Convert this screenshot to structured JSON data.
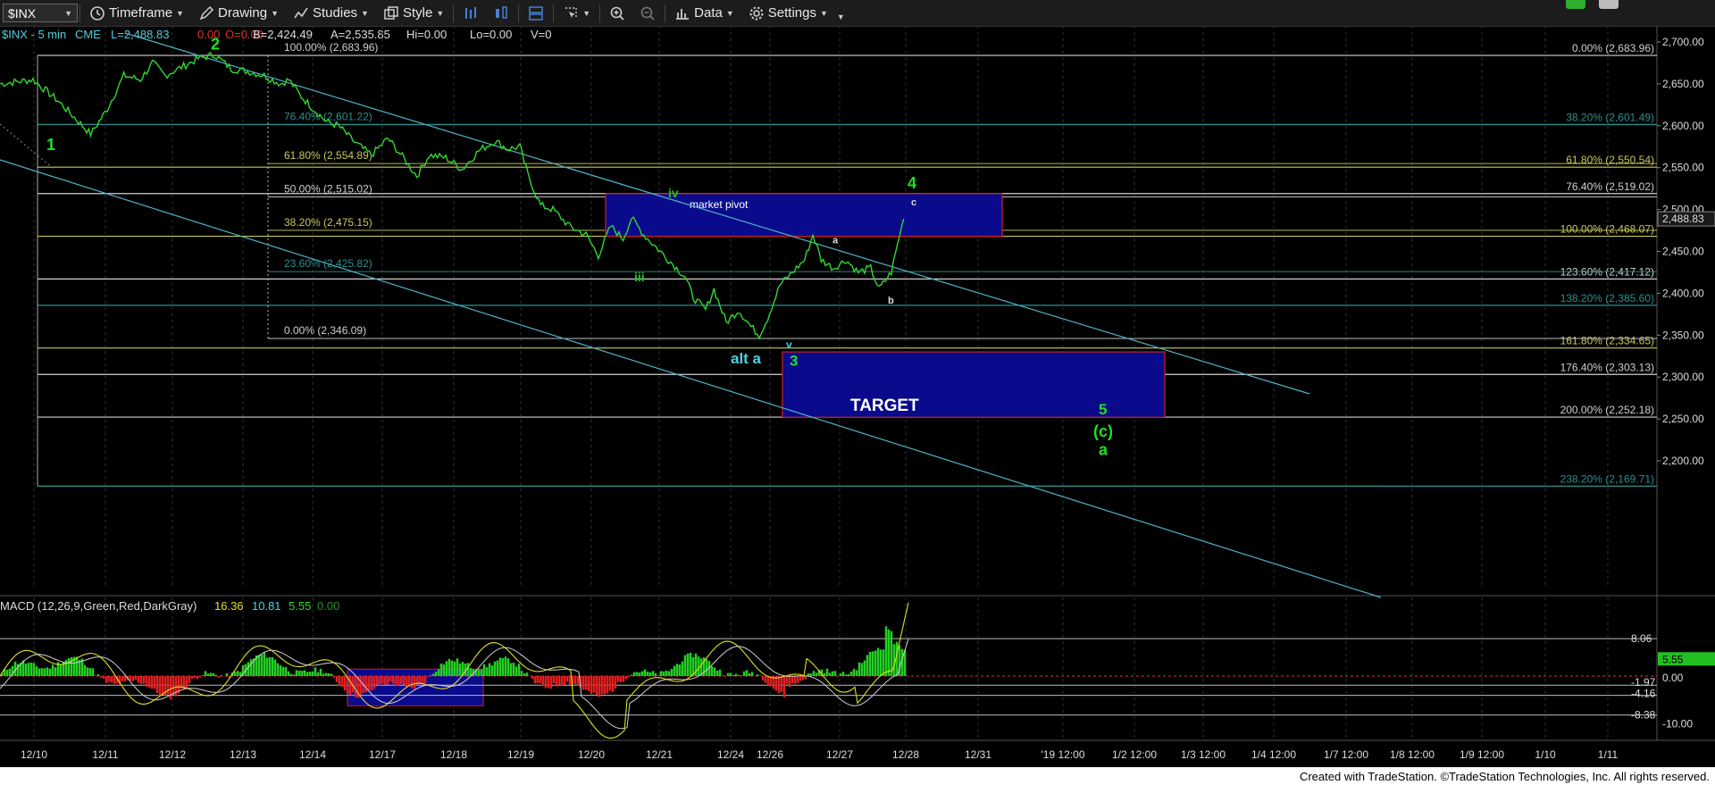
{
  "toolbar": {
    "symbol": "$INX",
    "timeframe": "Timeframe",
    "drawing": "Drawing",
    "studies": "Studies",
    "style": "Style",
    "data": "Data",
    "settings": "Settings",
    "icons": [
      "chart-bars-icon",
      "chart-candles-icon",
      "chart-line-icon",
      "layout-icon",
      "cursor-icon",
      "zoom-in-icon",
      "zoom-out-icon",
      "data-icon",
      "gear-icon"
    ]
  },
  "header": {
    "symbol_line": "$INX - 5 min",
    "cme": "CME",
    "last": "L=2,488.83",
    "change": "0.00",
    "pct": "O=0.00",
    "bid": "B=2,424.49",
    "ask": "A=2,535.85",
    "hi": "Hi=0.00",
    "lo": "Lo=0.00",
    "vol": "V=0"
  },
  "macd_header": {
    "label": "MACD (12,26,9,Green,Red,DarkGray)",
    "v1": "16.36",
    "v2": "10.81",
    "v3": "5.55",
    "v4": "0.00"
  },
  "footer": "Created with TradeStation. ©TradeStation Technologies, Inc. All rights reserved.",
  "colors": {
    "price": "#33d633",
    "fib_white": "#cfcfcf",
    "fib_yellow": "#c8c85a",
    "fib_teal": "#2b8f8f",
    "channel": "#4fb3c8",
    "box_fill": "#0a0a8c",
    "box_border": "#d02020",
    "green_label": "#22e022",
    "cyan_label": "#4fd0e0"
  },
  "chart_data": {
    "type": "line",
    "title": "$INX - 5 min",
    "y_axis": {
      "min": 2150,
      "max": 2720,
      "ticks": [
        2200,
        2250,
        2300,
        2350,
        2400,
        2450,
        2500,
        2550,
        2600,
        2650,
        2700
      ],
      "tick_labels": [
        "2,200.00",
        "2,250.00",
        "2,300.00",
        "2,350.00",
        "2,400.00",
        "2,450.00",
        "2,500.00",
        "2,550.00",
        "2,600.00",
        "2,650.00",
        "2,700.00"
      ]
    },
    "x_labels": [
      "12/10",
      "12/11",
      "12/12",
      "12/13",
      "12/14",
      "12/17",
      "12/18",
      "12/19",
      "12/20",
      "12/21",
      "12/24",
      "12/26",
      "12/27",
      "12/28",
      "12/31",
      "'19 12:00",
      "1/2 12:00",
      "1/3 12:00",
      "1/4 12:00",
      "1/7 12:00",
      "1/8 12:00",
      "1/9 12:00",
      "1/10",
      "1/11"
    ],
    "last_price": "2,488.83",
    "price_series": [
      [
        0,
        2650
      ],
      [
        8,
        2655
      ],
      [
        14,
        2630
      ],
      [
        20,
        2600
      ],
      [
        22,
        2590
      ],
      [
        26,
        2620
      ],
      [
        30,
        2660
      ],
      [
        34,
        2655
      ],
      [
        37,
        2675
      ],
      [
        40,
        2660
      ],
      [
        44,
        2670
      ],
      [
        48,
        2680
      ],
      [
        52,
        2685
      ],
      [
        56,
        2668
      ],
      [
        60,
        2665
      ],
      [
        64,
        2660
      ],
      [
        68,
        2650
      ],
      [
        70,
        2655
      ],
      [
        73,
        2635
      ],
      [
        76,
        2620
      ],
      [
        79,
        2605
      ],
      [
        82,
        2600
      ],
      [
        86,
        2580
      ],
      [
        90,
        2565
      ],
      [
        94,
        2585
      ],
      [
        98,
        2560
      ],
      [
        101,
        2540
      ],
      [
        104,
        2565
      ],
      [
        108,
        2562
      ],
      [
        112,
        2548
      ],
      [
        116,
        2570
      ],
      [
        120,
        2582
      ],
      [
        123,
        2572
      ],
      [
        126,
        2575
      ],
      [
        128,
        2540
      ],
      [
        131,
        2505
      ],
      [
        134,
        2500
      ],
      [
        138,
        2480
      ],
      [
        142,
        2470
      ],
      [
        145,
        2445
      ],
      [
        148,
        2480
      ],
      [
        151,
        2465
      ],
      [
        153,
        2490
      ],
      [
        156,
        2470
      ],
      [
        160,
        2450
      ],
      [
        163,
        2435
      ],
      [
        166,
        2420
      ],
      [
        168,
        2395
      ],
      [
        171,
        2380
      ],
      [
        173,
        2405
      ],
      [
        176,
        2365
      ],
      [
        179,
        2380
      ],
      [
        182,
        2360
      ],
      [
        184,
        2350
      ],
      [
        186,
        2370
      ],
      [
        189,
        2410
      ],
      [
        192,
        2425
      ],
      [
        195,
        2440
      ],
      [
        197,
        2470
      ],
      [
        199,
        2440
      ],
      [
        202,
        2430
      ],
      [
        205,
        2440
      ],
      [
        208,
        2425
      ],
      [
        211,
        2430
      ],
      [
        213,
        2405
      ],
      [
        216,
        2425
      ],
      [
        218,
        2470
      ],
      [
        219,
        2488.83
      ]
    ],
    "fib_left": [
      {
        "pct": "100.00%",
        "value": "2,683.96",
        "level": 2683.96
      },
      {
        "pct": "76.40%",
        "value": "2,601.22",
        "level": 2601.22
      },
      {
        "pct": "61.80%",
        "value": "2,554.89",
        "level": 2554.89
      },
      {
        "pct": "50.00%",
        "value": "2,515.02",
        "level": 2515.02
      },
      {
        "pct": "38.20%",
        "value": "2,475.15",
        "level": 2475.15
      },
      {
        "pct": "23.60%",
        "value": "2,425.82",
        "level": 2425.82
      },
      {
        "pct": "0.00%",
        "value": "2,346.09",
        "level": 2346.09
      }
    ],
    "fib_right": [
      {
        "pct": "0.00%",
        "value": "2,683.96",
        "level": 2683.96,
        "color": "white"
      },
      {
        "pct": "38.20%",
        "value": "2,601.49",
        "level": 2601.49,
        "color": "teal"
      },
      {
        "pct": "61.80%",
        "value": "2,550.54",
        "level": 2550.54,
        "color": "yellow"
      },
      {
        "pct": "76.40%",
        "value": "2,519.02",
        "level": 2519.02,
        "color": "white"
      },
      {
        "pct": "100.00%",
        "value": "2,468.07",
        "level": 2468.07,
        "color": "yellow"
      },
      {
        "pct": "123.60%",
        "value": "2,417.12",
        "level": 2417.12,
        "color": "white"
      },
      {
        "pct": "138.20%",
        "value": "2,385.60",
        "level": 2385.6,
        "color": "teal"
      },
      {
        "pct": "161.80%",
        "value": "2,334.65",
        "level": 2334.65,
        "color": "yellow"
      },
      {
        "pct": "176.40%",
        "value": "2,303.13",
        "level": 2303.13,
        "color": "white"
      },
      {
        "pct": "200.00%",
        "value": "2,252.18",
        "level": 2252.18,
        "color": "white"
      },
      {
        "pct": "238.20%",
        "value": "2,169.71",
        "level": 2169.71,
        "color": "teal"
      }
    ],
    "boxes": [
      {
        "label": "market pivot",
        "top": 2519,
        "bottom": 2468
      },
      {
        "label": "TARGET",
        "top": 2330,
        "bottom": 2252
      }
    ],
    "wave_labels": {
      "w1": "1",
      "w2": "2",
      "w3": "3",
      "w4": "4",
      "w5": "5",
      "iii": "iii",
      "iv": "iv",
      "v": "v",
      "a": "a",
      "b": "b",
      "c": "c",
      "c_paren": "(c)",
      "a_big": "a",
      "alt_a": "alt a"
    },
    "macd": {
      "y_ticks": [
        "8.06",
        "5.55",
        "-1.97",
        "0.00",
        "-4.16",
        "-8.38",
        "-10.00"
      ],
      "y_range": [
        -14,
        19
      ]
    }
  }
}
